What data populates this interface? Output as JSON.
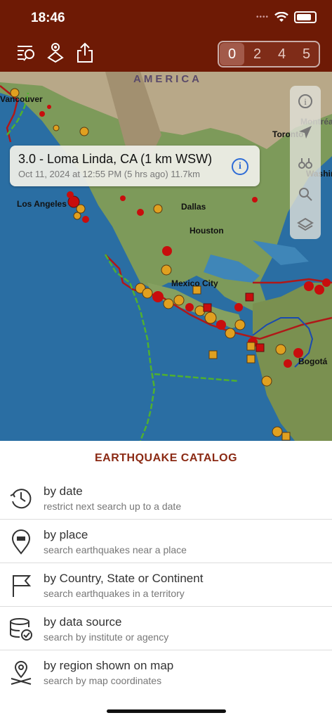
{
  "status": {
    "time": "18:46"
  },
  "toolbar": {
    "icons": [
      "list-search-icon",
      "locator-icon",
      "share-icon"
    ],
    "magnitude_filter": [
      "0",
      "2",
      "4",
      "5"
    ],
    "selected": "0"
  },
  "map": {
    "region_label": "AMERICA",
    "cities": [
      "Vancouver",
      "Toronto",
      "Montréal",
      "Washington",
      "Los Angeles",
      "Dallas",
      "Houston",
      "Mexico City",
      "Bogotá"
    ],
    "colors": {
      "quake_recent": "#c80d0d",
      "quake_old": "#e0a020",
      "plate_boundary": "#b01818",
      "rift": "#4fb030"
    }
  },
  "popup": {
    "title": "3.0 - Loma Linda, CA (1 km WSW)",
    "subtitle": "Oct 11, 2024 at 12:55 PM (5 hrs ago) 11.7km"
  },
  "map_controls": [
    "info-icon",
    "location-arrow-icon",
    "binoculars-icon",
    "search-icon",
    "layers-icon"
  ],
  "catalog": {
    "title": "EARTHQUAKE CATALOG",
    "items": [
      {
        "title": "by date",
        "subtitle": "restrict next search up to a date",
        "icon": "clock-history-icon"
      },
      {
        "title": "by place",
        "subtitle": "search earthquakes near a place",
        "icon": "map-pin-icon"
      },
      {
        "title": "by Country, State or Continent",
        "subtitle": "search earthquakes in a territory",
        "icon": "flag-icon"
      },
      {
        "title": "by data source",
        "subtitle": "search by institute or agency",
        "icon": "database-check-icon"
      },
      {
        "title": "by region shown on map",
        "subtitle": "search by map coordinates",
        "icon": "region-pin-icon"
      }
    ]
  }
}
